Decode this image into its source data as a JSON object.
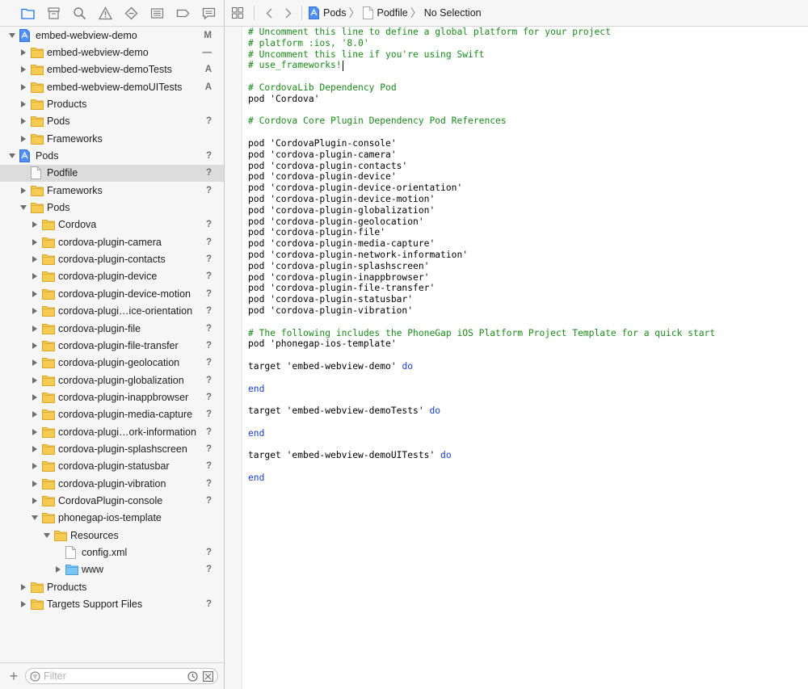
{
  "colors": {
    "selection": "#dcdcdc",
    "folder": "#f5cb52",
    "project_icon": "#4f8ff7",
    "comment": "#1a8a1a",
    "keyword": "#1a3fd6",
    "status": "#6e6e6e"
  },
  "navigator_toolbar": [
    {
      "name": "project-navigator-icon"
    },
    {
      "name": "source-control-navigator-icon"
    },
    {
      "name": "find-navigator-icon"
    },
    {
      "name": "issue-navigator-icon"
    },
    {
      "name": "test-navigator-icon"
    },
    {
      "name": "debug-navigator-icon"
    },
    {
      "name": "breakpoint-navigator-icon"
    },
    {
      "name": "report-navigator-icon"
    }
  ],
  "tree": [
    {
      "label": "embed-webview-demo",
      "status": "M",
      "icon": "project",
      "depth": 0,
      "expanded": true
    },
    {
      "label": "embed-webview-demo",
      "status": "—",
      "icon": "folder",
      "depth": 1,
      "expanded": false
    },
    {
      "label": "embed-webview-demoTests",
      "status": "A",
      "icon": "folder",
      "depth": 1,
      "expanded": false
    },
    {
      "label": "embed-webview-demoUITests",
      "status": "A",
      "icon": "folder",
      "depth": 1,
      "expanded": false
    },
    {
      "label": "Products",
      "status": "",
      "icon": "folder",
      "depth": 1,
      "expanded": false
    },
    {
      "label": "Pods",
      "status": "?",
      "icon": "folder",
      "depth": 1,
      "expanded": false
    },
    {
      "label": "Frameworks",
      "status": "",
      "icon": "folder",
      "depth": 1,
      "expanded": false
    },
    {
      "label": "Pods",
      "status": "?",
      "icon": "project",
      "depth": 0,
      "expanded": true
    },
    {
      "label": "Podfile",
      "status": "?",
      "icon": "file",
      "depth": 1,
      "expanded": null,
      "selected": true
    },
    {
      "label": "Frameworks",
      "status": "?",
      "icon": "folder",
      "depth": 1,
      "expanded": false
    },
    {
      "label": "Pods",
      "status": "",
      "icon": "folder",
      "depth": 1,
      "expanded": true
    },
    {
      "label": "Cordova",
      "status": "?",
      "icon": "folder",
      "depth": 2,
      "expanded": false
    },
    {
      "label": "cordova-plugin-camera",
      "status": "?",
      "icon": "folder",
      "depth": 2,
      "expanded": false
    },
    {
      "label": "cordova-plugin-contacts",
      "status": "?",
      "icon": "folder",
      "depth": 2,
      "expanded": false
    },
    {
      "label": "cordova-plugin-device",
      "status": "?",
      "icon": "folder",
      "depth": 2,
      "expanded": false
    },
    {
      "label": "cordova-plugin-device-motion",
      "status": "?",
      "icon": "folder",
      "depth": 2,
      "expanded": false
    },
    {
      "label": "cordova-plugi…ice-orientation",
      "status": "?",
      "icon": "folder",
      "depth": 2,
      "expanded": false
    },
    {
      "label": "cordova-plugin-file",
      "status": "?",
      "icon": "folder",
      "depth": 2,
      "expanded": false
    },
    {
      "label": "cordova-plugin-file-transfer",
      "status": "?",
      "icon": "folder",
      "depth": 2,
      "expanded": false
    },
    {
      "label": "cordova-plugin-geolocation",
      "status": "?",
      "icon": "folder",
      "depth": 2,
      "expanded": false
    },
    {
      "label": "cordova-plugin-globalization",
      "status": "?",
      "icon": "folder",
      "depth": 2,
      "expanded": false
    },
    {
      "label": "cordova-plugin-inappbrowser",
      "status": "?",
      "icon": "folder",
      "depth": 2,
      "expanded": false
    },
    {
      "label": "cordova-plugin-media-capture",
      "status": "?",
      "icon": "folder",
      "depth": 2,
      "expanded": false
    },
    {
      "label": "cordova-plugi…ork-information",
      "status": "?",
      "icon": "folder",
      "depth": 2,
      "expanded": false
    },
    {
      "label": "cordova-plugin-splashscreen",
      "status": "?",
      "icon": "folder",
      "depth": 2,
      "expanded": false
    },
    {
      "label": "cordova-plugin-statusbar",
      "status": "?",
      "icon": "folder",
      "depth": 2,
      "expanded": false
    },
    {
      "label": "cordova-plugin-vibration",
      "status": "?",
      "icon": "folder",
      "depth": 2,
      "expanded": false
    },
    {
      "label": "CordovaPlugin-console",
      "status": "?",
      "icon": "folder",
      "depth": 2,
      "expanded": false
    },
    {
      "label": "phonegap-ios-template",
      "status": "",
      "icon": "folder",
      "depth": 2,
      "expanded": true
    },
    {
      "label": "Resources",
      "status": "",
      "icon": "folder",
      "depth": 3,
      "expanded": true
    },
    {
      "label": "config.xml",
      "status": "?",
      "icon": "file",
      "depth": 4,
      "expanded": null
    },
    {
      "label": "www",
      "status": "?",
      "icon": "blue-folder",
      "depth": 4,
      "expanded": false
    },
    {
      "label": "Products",
      "status": "",
      "icon": "folder",
      "depth": 1,
      "expanded": false
    },
    {
      "label": "Targets Support Files",
      "status": "?",
      "icon": "folder",
      "depth": 1,
      "expanded": false
    }
  ],
  "filter": {
    "placeholder": "Filter",
    "value": ""
  },
  "jumpbar": {
    "crumbs": [
      {
        "label": "Pods",
        "icon": "project"
      },
      {
        "label": "Podfile",
        "icon": "file"
      },
      {
        "label": "No Selection",
        "icon": ""
      }
    ]
  },
  "code_lines": [
    {
      "text": "# Uncomment this line to define a global platform for your project",
      "type": "comment"
    },
    {
      "text": "# platform :ios, '8.0'",
      "type": "comment"
    },
    {
      "text": "# Uncomment this line if you're using Swift",
      "type": "comment"
    },
    {
      "text": "# use_frameworks!",
      "type": "comment",
      "cursor": true
    },
    {
      "text": "",
      "type": "plain"
    },
    {
      "text": "# CordovaLib Dependency Pod",
      "type": "comment"
    },
    {
      "text": "pod 'Cordova'",
      "type": "plain"
    },
    {
      "text": "",
      "type": "plain"
    },
    {
      "text": "# Cordova Core Plugin Dependency Pod References",
      "type": "comment"
    },
    {
      "text": "",
      "type": "plain"
    },
    {
      "text": "pod 'CordovaPlugin-console'",
      "type": "plain"
    },
    {
      "text": "pod 'cordova-plugin-camera'",
      "type": "plain"
    },
    {
      "text": "pod 'cordova-plugin-contacts'",
      "type": "plain"
    },
    {
      "text": "pod 'cordova-plugin-device'",
      "type": "plain"
    },
    {
      "text": "pod 'cordova-plugin-device-orientation'",
      "type": "plain"
    },
    {
      "text": "pod 'cordova-plugin-device-motion'",
      "type": "plain"
    },
    {
      "text": "pod 'cordova-plugin-globalization'",
      "type": "plain"
    },
    {
      "text": "pod 'cordova-plugin-geolocation'",
      "type": "plain"
    },
    {
      "text": "pod 'cordova-plugin-file'",
      "type": "plain"
    },
    {
      "text": "pod 'cordova-plugin-media-capture'",
      "type": "plain"
    },
    {
      "text": "pod 'cordova-plugin-network-information'",
      "type": "plain"
    },
    {
      "text": "pod 'cordova-plugin-splashscreen'",
      "type": "plain"
    },
    {
      "text": "pod 'cordova-plugin-inappbrowser'",
      "type": "plain"
    },
    {
      "text": "pod 'cordova-plugin-file-transfer'",
      "type": "plain"
    },
    {
      "text": "pod 'cordova-plugin-statusbar'",
      "type": "plain"
    },
    {
      "text": "pod 'cordova-plugin-vibration'",
      "type": "plain"
    },
    {
      "text": "",
      "type": "plain"
    },
    {
      "text": "# The following includes the PhoneGap iOS Platform Project Template for a quick start",
      "type": "comment"
    },
    {
      "text": "pod 'phonegap-ios-template'",
      "type": "plain"
    },
    {
      "text": "",
      "type": "plain"
    },
    {
      "text": "target 'embed-webview-demo' ",
      "type": "plain",
      "kw": "do"
    },
    {
      "text": "",
      "type": "plain"
    },
    {
      "text": "",
      "type": "plain",
      "kw": "end"
    },
    {
      "text": "",
      "type": "plain"
    },
    {
      "text": "target 'embed-webview-demoTests' ",
      "type": "plain",
      "kw": "do"
    },
    {
      "text": "",
      "type": "plain"
    },
    {
      "text": "",
      "type": "plain",
      "kw": "end"
    },
    {
      "text": "",
      "type": "plain"
    },
    {
      "text": "target 'embed-webview-demoUITests' ",
      "type": "plain",
      "kw": "do"
    },
    {
      "text": "",
      "type": "plain"
    },
    {
      "text": "",
      "type": "plain",
      "kw": "end"
    }
  ]
}
